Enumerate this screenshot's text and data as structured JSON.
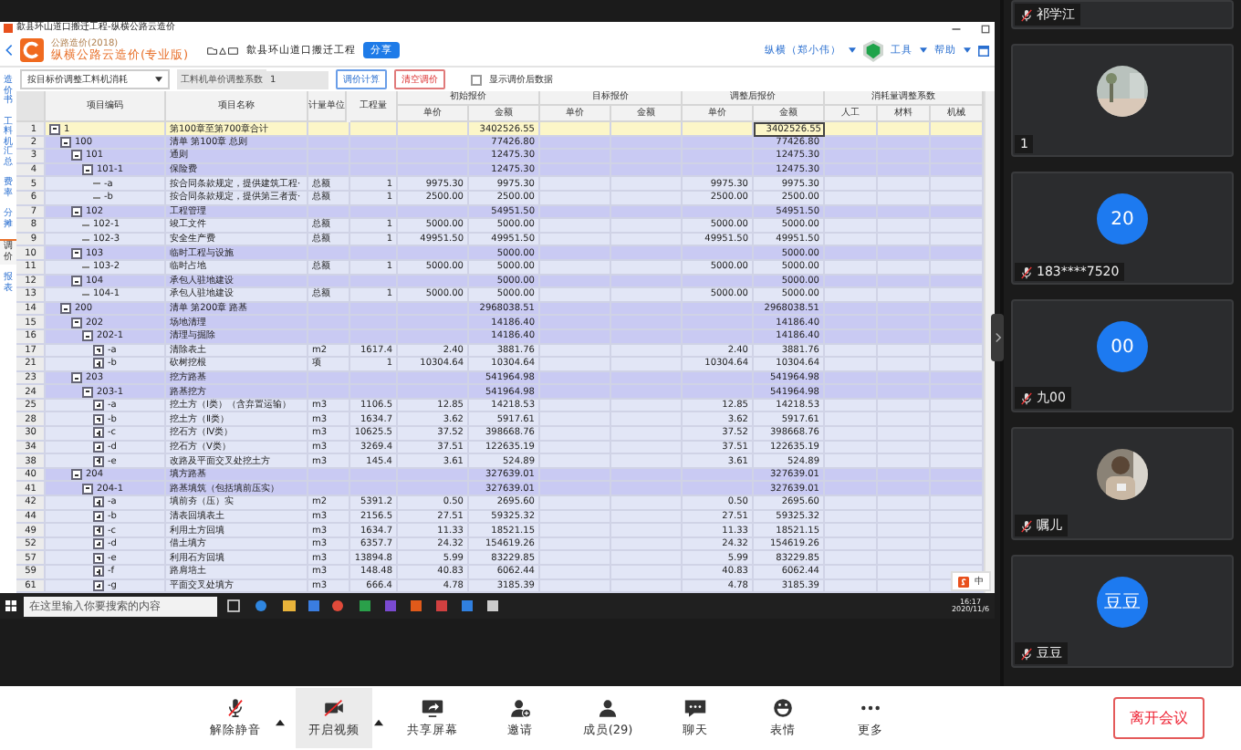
{
  "window": {
    "title": "歙县环山道口搬迁工程-纵横公路云造价"
  },
  "app": {
    "subtitle": "公路造价(2018)",
    "name": "纵横公路云造价(专业版)",
    "project": "歙县环山道口搬迁工程",
    "share_button": "分享",
    "user": "纵横（郑小伟）",
    "tools": "工具",
    "help": "帮助"
  },
  "side_tabs": [
    {
      "label": "造价书",
      "selected": false
    },
    {
      "label": "工料机汇总",
      "selected": false
    },
    {
      "label": "费率",
      "selected": false
    },
    {
      "label": "分摊",
      "selected": false
    },
    {
      "label": "调价",
      "selected": true
    },
    {
      "label": "报表",
      "selected": false
    }
  ],
  "adjust_toolbar": {
    "mode": "按目标价调整工料机消耗",
    "factor_label": "工料机单价调整系数",
    "factor": "1",
    "calc_button": "调价计算",
    "clear_button": "清空调价",
    "show_adjusted": {
      "label": "显示调价后数据",
      "checked": false
    }
  },
  "table": {
    "columns": {
      "code": "项目编码",
      "name": "项目名称",
      "unit": "计量单位",
      "quantity": "工程量",
      "groups": [
        {
          "label": "初始报价",
          "subs": [
            "单价",
            "金额"
          ]
        },
        {
          "label": "目标报价",
          "subs": [
            "单价",
            "金额"
          ]
        },
        {
          "label": "调整后报价",
          "subs": [
            "单价",
            "金额"
          ]
        },
        {
          "label": "消耗量调整系数",
          "subs": [
            "人工",
            "材料",
            "机械"
          ]
        }
      ]
    },
    "rows": [
      {
        "row_number": "1",
        "code": "1",
        "name": "第100章至第700章合计",
        "initial_amount": "3402526.55",
        "adjusted_amount": "3402526.55",
        "expanded": true,
        "selected": true,
        "children": [
          {
            "row_number": "2",
            "code": "100",
            "name": "清单 第100章 总则",
            "initial_amount": "77426.80",
            "adjusted_amount": "77426.80",
            "expanded": true,
            "selected": false,
            "children": [
              {
                "row_number": "3",
                "code": "101",
                "name": "通则",
                "initial_amount": "12475.30",
                "adjusted_amount": "12475.30",
                "expanded": true,
                "selected": false,
                "children": [
                  {
                    "row_number": "4",
                    "code": "101-1",
                    "name": "保险费",
                    "initial_amount": "12475.30",
                    "adjusted_amount": "12475.30",
                    "expanded": true,
                    "selected": false,
                    "children": [
                      {
                        "row_number": "5",
                        "code": "-a",
                        "name": "按合同条款规定，提供建筑工程·",
                        "unit": "总额",
                        "quantity": "1",
                        "initial_price": "9975.30",
                        "initial_amount": "9975.30",
                        "adjusted_price": "9975.30",
                        "adjusted_amount": "9975.30",
                        "selected": false
                      },
                      {
                        "row_number": "6",
                        "code": "-b",
                        "name": "按合同条款规定，提供第三者责·",
                        "unit": "总额",
                        "quantity": "1",
                        "initial_price": "2500.00",
                        "initial_amount": "2500.00",
                        "adjusted_price": "2500.00",
                        "adjusted_amount": "2500.00",
                        "selected": false
                      }
                    ]
                  }
                ]
              },
              {
                "row_number": "7",
                "code": "102",
                "name": "工程管理",
                "initial_amount": "54951.50",
                "adjusted_amount": "54951.50",
                "expanded": true,
                "selected": false,
                "children": [
                  {
                    "row_number": "8",
                    "code": "102-1",
                    "name": "竣工文件",
                    "unit": "总额",
                    "quantity": "1",
                    "initial_price": "5000.00",
                    "initial_amount": "5000.00",
                    "adjusted_price": "5000.00",
                    "adjusted_amount": "5000.00",
                    "selected": false
                  },
                  {
                    "row_number": "9",
                    "code": "102-3",
                    "name": "安全生产费",
                    "unit": "总额",
                    "quantity": "1",
                    "initial_price": "49951.50",
                    "initial_amount": "49951.50",
                    "adjusted_price": "49951.50",
                    "adjusted_amount": "49951.50",
                    "selected": false
                  }
                ]
              },
              {
                "row_number": "10",
                "code": "103",
                "name": "临时工程与设施",
                "initial_amount": "5000.00",
                "adjusted_amount": "5000.00",
                "expanded": true,
                "selected": false,
                "children": [
                  {
                    "row_number": "11",
                    "code": "103-2",
                    "name": "临时占地",
                    "unit": "总额",
                    "quantity": "1",
                    "initial_price": "5000.00",
                    "initial_amount": "5000.00",
                    "adjusted_price": "5000.00",
                    "adjusted_amount": "5000.00",
                    "selected": false
                  }
                ]
              },
              {
                "row_number": "12",
                "code": "104",
                "name": "承包人驻地建设",
                "initial_amount": "5000.00",
                "adjusted_amount": "5000.00",
                "expanded": true,
                "selected": false,
                "children": [
                  {
                    "row_number": "13",
                    "code": "104-1",
                    "name": "承包人驻地建设",
                    "unit": "总额",
                    "quantity": "1",
                    "initial_price": "5000.00",
                    "initial_amount": "5000.00",
                    "adjusted_price": "5000.00",
                    "adjusted_amount": "5000.00",
                    "selected": false
                  }
                ]
              }
            ]
          },
          {
            "row_number": "14",
            "code": "200",
            "name": "清单 第200章 路基",
            "initial_amount": "2968038.51",
            "adjusted_amount": "2968038.51",
            "expanded": true,
            "selected": false,
            "children": [
              {
                "row_number": "15",
                "code": "202",
                "name": "场地清理",
                "initial_amount": "14186.40",
                "adjusted_amount": "14186.40",
                "expanded": true,
                "selected": false,
                "children": [
                  {
                    "row_number": "16",
                    "code": "202-1",
                    "name": "清理与掘除",
                    "initial_amount": "14186.40",
                    "adjusted_amount": "14186.40",
                    "expanded": true,
                    "selected": false,
                    "children": [
                      {
                        "row_number": "17",
                        "code": "-a",
                        "name": "清除表土",
                        "unit": "m2",
                        "quantity": "1617.4",
                        "initial_price": "2.40",
                        "initial_amount": "3881.76",
                        "adjusted_price": "2.40",
                        "adjusted_amount": "3881.76",
                        "expanded": false,
                        "selected": false
                      },
                      {
                        "row_number": "21",
                        "code": "-b",
                        "name": "砍树挖根",
                        "unit": "项",
                        "quantity": "1",
                        "initial_price": "10304.64",
                        "initial_amount": "10304.64",
                        "adjusted_price": "10304.64",
                        "adjusted_amount": "10304.64",
                        "expanded": false,
                        "selected": false
                      }
                    ]
                  }
                ]
              },
              {
                "row_number": "23",
                "code": "203",
                "name": "挖方路基",
                "initial_amount": "541964.98",
                "adjusted_amount": "541964.98",
                "expanded": true,
                "selected": false,
                "children": [
                  {
                    "row_number": "24",
                    "code": "203-1",
                    "name": "路基挖方",
                    "initial_amount": "541964.98",
                    "adjusted_amount": "541964.98",
                    "expanded": true,
                    "selected": false,
                    "children": [
                      {
                        "row_number": "25",
                        "code": "-a",
                        "name": "挖土方（Ⅰ类）（含弃置运输）",
                        "unit": "m3",
                        "quantity": "1106.5",
                        "initial_price": "12.85",
                        "initial_amount": "14218.53",
                        "adjusted_price": "12.85",
                        "adjusted_amount": "14218.53",
                        "expanded": false,
                        "selected": false
                      },
                      {
                        "row_number": "28",
                        "code": "-b",
                        "name": "挖土方（Ⅱ类）",
                        "unit": "m3",
                        "quantity": "1634.7",
                        "initial_price": "3.62",
                        "initial_amount": "5917.61",
                        "adjusted_price": "3.62",
                        "adjusted_amount": "5917.61",
                        "expanded": false,
                        "selected": false
                      },
                      {
                        "row_number": "30",
                        "code": "-c",
                        "name": "挖石方（Ⅳ类）",
                        "unit": "m3",
                        "quantity": "10625.5",
                        "initial_price": "37.52",
                        "initial_amount": "398668.76",
                        "adjusted_price": "37.52",
                        "adjusted_amount": "398668.76",
                        "expanded": false,
                        "selected": false
                      },
                      {
                        "row_number": "34",
                        "code": "-d",
                        "name": "挖石方（Ⅴ类）",
                        "unit": "m3",
                        "quantity": "3269.4",
                        "initial_price": "37.51",
                        "initial_amount": "122635.19",
                        "adjusted_price": "37.51",
                        "adjusted_amount": "122635.19",
                        "expanded": false,
                        "selected": false
                      },
                      {
                        "row_number": "38",
                        "code": "-e",
                        "name": "改路及平面交叉处挖土方",
                        "unit": "m3",
                        "quantity": "145.4",
                        "initial_price": "3.61",
                        "initial_amount": "524.89",
                        "adjusted_price": "3.61",
                        "adjusted_amount": "524.89",
                        "expanded": false,
                        "selected": false
                      }
                    ]
                  }
                ]
              },
              {
                "row_number": "40",
                "code": "204",
                "name": "填方路基",
                "initial_amount": "327639.01",
                "adjusted_amount": "327639.01",
                "expanded": true,
                "selected": false,
                "children": [
                  {
                    "row_number": "41",
                    "code": "204-1",
                    "name": "路基填筑（包括填前压实）",
                    "initial_amount": "327639.01",
                    "adjusted_amount": "327639.01",
                    "expanded": true,
                    "selected": false,
                    "children": [
                      {
                        "row_number": "42",
                        "code": "-a",
                        "name": "填前夯（压）实",
                        "unit": "m2",
                        "quantity": "5391.2",
                        "initial_price": "0.50",
                        "initial_amount": "2695.60",
                        "adjusted_price": "0.50",
                        "adjusted_amount": "2695.60",
                        "expanded": false,
                        "selected": false
                      },
                      {
                        "row_number": "44",
                        "code": "-b",
                        "name": "清表回填表土",
                        "unit": "m3",
                        "quantity": "2156.5",
                        "initial_price": "27.51",
                        "initial_amount": "59325.32",
                        "adjusted_price": "27.51",
                        "adjusted_amount": "59325.32",
                        "expanded": false,
                        "selected": false
                      },
                      {
                        "row_number": "49",
                        "code": "-c",
                        "name": "利用土方回填",
                        "unit": "m3",
                        "quantity": "1634.7",
                        "initial_price": "11.33",
                        "initial_amount": "18521.15",
                        "adjusted_price": "11.33",
                        "adjusted_amount": "18521.15",
                        "expanded": false,
                        "selected": false
                      },
                      {
                        "row_number": "52",
                        "code": "-d",
                        "name": "借土填方",
                        "unit": "m3",
                        "quantity": "6357.7",
                        "initial_price": "24.32",
                        "initial_amount": "154619.26",
                        "adjusted_price": "24.32",
                        "adjusted_amount": "154619.26",
                        "expanded": false,
                        "selected": false
                      },
                      {
                        "row_number": "57",
                        "code": "-e",
                        "name": "利用石方回填",
                        "unit": "m3",
                        "quantity": "13894.8",
                        "initial_price": "5.99",
                        "initial_amount": "83229.85",
                        "adjusted_price": "5.99",
                        "adjusted_amount": "83229.85",
                        "expanded": false,
                        "selected": false
                      },
                      {
                        "row_number": "59",
                        "code": "-f",
                        "name": "路肩培土",
                        "unit": "m3",
                        "quantity": "148.48",
                        "initial_price": "40.83",
                        "initial_amount": "6062.44",
                        "adjusted_price": "40.83",
                        "adjusted_amount": "6062.44",
                        "expanded": false,
                        "selected": false
                      },
                      {
                        "row_number": "61",
                        "code": "-g",
                        "name": "平面交叉处填方",
                        "unit": "m3",
                        "quantity": "666.4",
                        "initial_price": "4.78",
                        "initial_amount": "3185.39",
                        "adjusted_price": "4.78",
                        "adjusted_amount": "3185.39",
                        "expanded": false,
                        "selected": false
                      }
                    ]
                  }
                ]
              }
            ]
          }
        ]
      }
    ]
  },
  "taskbar": {
    "search_placeholder": "在这里输入你要搜索的内容",
    "ime": "中",
    "time": "16:17",
    "date": "2020/11/6"
  },
  "participants": [
    {
      "name": "祁学江",
      "kind": "partial",
      "muted": true
    },
    {
      "name": "1",
      "kind": "picture",
      "muted": false
    },
    {
      "name": "183****7520",
      "kind": "initials",
      "avatar_text": "20",
      "muted": true
    },
    {
      "name": "九00",
      "kind": "initials",
      "avatar_text": "00",
      "muted": true
    },
    {
      "name": "嘱儿",
      "kind": "picture",
      "muted": true
    },
    {
      "name": "豆豆",
      "kind": "initials",
      "avatar_text": "豆豆",
      "muted": true
    }
  ],
  "meeting_toolbar": {
    "items": [
      {
        "label": "解除静音",
        "kind": "mic",
        "menu": true,
        "selected": false
      },
      {
        "label": "开启视频",
        "kind": "video",
        "menu": true,
        "selected": true
      },
      {
        "label": "共享屏幕",
        "kind": "share",
        "menu": false,
        "selected": false
      },
      {
        "label": "邀请",
        "kind": "invite",
        "menu": false,
        "selected": false
      },
      {
        "label": "成员(29)",
        "kind": "members",
        "menu": false,
        "selected": false
      },
      {
        "label": "聊天",
        "kind": "chat",
        "menu": false,
        "selected": false
      },
      {
        "label": "表情",
        "kind": "emoji",
        "menu": false,
        "selected": false
      },
      {
        "label": "更多",
        "kind": "more",
        "menu": false,
        "selected": false
      }
    ],
    "leave_button": "离开会议"
  }
}
